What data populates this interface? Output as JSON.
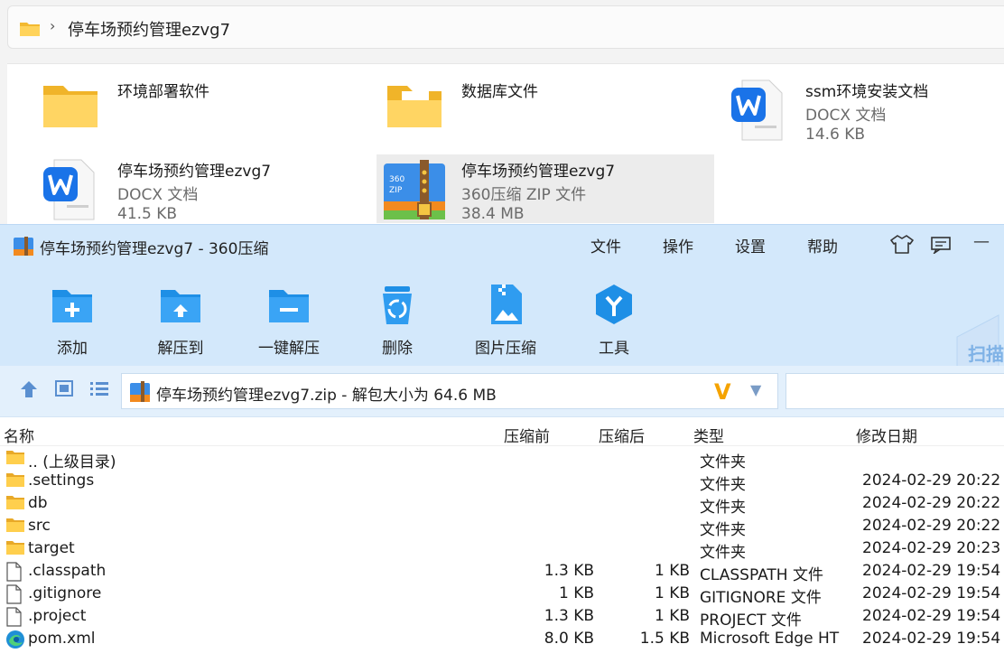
{
  "explorer": {
    "breadcrumb": "停车场预约管理ezvg7",
    "breadcrumb_chevron": "›",
    "items": [
      {
        "name": "环境部署软件",
        "type": "",
        "size": "",
        "icon": "folder-icon"
      },
      {
        "name": "数据库文件",
        "type": "",
        "size": "",
        "icon": "folder-open-icon"
      },
      {
        "name": "ssm环境安装文档",
        "type": "DOCX 文档",
        "size": "14.6 KB",
        "icon": "wps-doc-icon"
      },
      {
        "name": "停车场预约管理ezvg7",
        "type": "DOCX 文档",
        "size": "41.5 KB",
        "icon": "wps-doc-icon"
      },
      {
        "name": "停车场预约管理ezvg7",
        "type": "360压缩 ZIP 文件",
        "size": "38.4 MB",
        "icon": "zip-360-icon",
        "selected": true
      }
    ]
  },
  "zip_window": {
    "title": "停车场预约管理ezvg7 - 360压缩",
    "menu": [
      "文件",
      "操作",
      "设置",
      "帮助"
    ],
    "minimize_label": "—",
    "toolbar": [
      {
        "label": "添加",
        "icon": "add-folder-icon"
      },
      {
        "label": "解压到",
        "icon": "extract-to-icon"
      },
      {
        "label": "一键解压",
        "icon": "one-click-extract-icon"
      },
      {
        "label": "删除",
        "icon": "recycle-delete-icon"
      },
      {
        "label": "图片压缩",
        "icon": "image-compress-icon"
      },
      {
        "label": "工具",
        "icon": "tools-icon"
      }
    ],
    "scan_label": "扫描",
    "path": "停车场预约管理ezvg7.zip - 解包大小为 64.6 MB",
    "path_badge": "V",
    "path_dropdown": "▼",
    "columns": [
      "名称",
      "压缩前",
      "压缩后",
      "类型",
      "修改日期"
    ],
    "rows": [
      {
        "name": ".. (上级目录)",
        "before": "",
        "after": "",
        "type": "文件夹",
        "date": "",
        "icon": "folder-icon"
      },
      {
        "name": ".settings",
        "before": "",
        "after": "",
        "type": "文件夹",
        "date": "2024-02-29 20:22",
        "icon": "folder-icon"
      },
      {
        "name": "db",
        "before": "",
        "after": "",
        "type": "文件夹",
        "date": "2024-02-29 20:22",
        "icon": "folder-icon"
      },
      {
        "name": "src",
        "before": "",
        "after": "",
        "type": "文件夹",
        "date": "2024-02-29 20:22",
        "icon": "folder-icon"
      },
      {
        "name": "target",
        "before": "",
        "after": "",
        "type": "文件夹",
        "date": "2024-02-29 20:23",
        "icon": "folder-icon"
      },
      {
        "name": ".classpath",
        "before": "1.3 KB",
        "after": "1 KB",
        "type": "CLASSPATH 文件",
        "date": "2024-02-29 19:54",
        "icon": "file-icon"
      },
      {
        "name": ".gitignore",
        "before": "1 KB",
        "after": "1 KB",
        "type": "GITIGNORE 文件",
        "date": "2024-02-29 19:54",
        "icon": "file-icon"
      },
      {
        "name": ".project",
        "before": "1.3 KB",
        "after": "1 KB",
        "type": "PROJECT 文件",
        "date": "2024-02-29 19:54",
        "icon": "file-icon"
      },
      {
        "name": "pom.xml",
        "before": "8.0 KB",
        "after": "1.5 KB",
        "type": "Microsoft Edge HT",
        "date": "2024-02-29 19:54",
        "icon": "edge-icon"
      }
    ]
  },
  "colors": {
    "window_chrome": "#d3e8fb",
    "accent_blue": "#1e8fe6",
    "folder_yellow": "#f7c548",
    "wps_blue": "#1a73e8",
    "selection": "#ececec"
  }
}
